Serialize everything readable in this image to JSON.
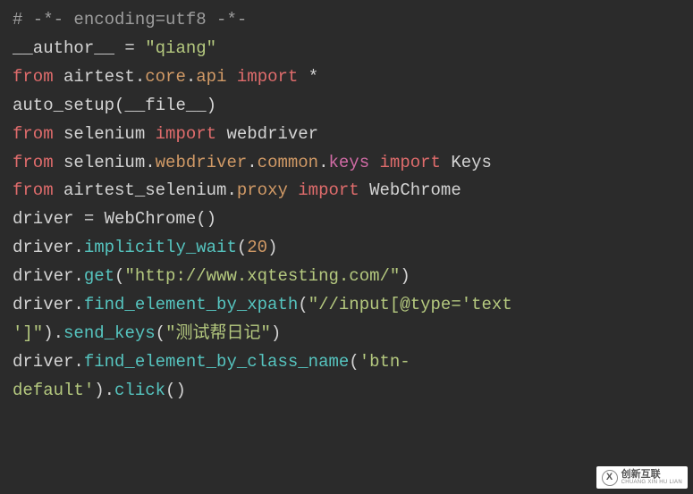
{
  "code": {
    "line1": {
      "comment": "# -*- encoding=utf8 -*-"
    },
    "line2": {
      "var": "__author__",
      "eq": " = ",
      "str": "\"qiang\""
    },
    "line3": {
      "blank": ""
    },
    "line4": {
      "from": "from",
      "sp1": " ",
      "mod": "airtest",
      "dot1": ".",
      "sub1": "core",
      "dot2": ".",
      "sub2": "api",
      "sp2": " ",
      "import": "import",
      "sp3": " ",
      "star": "*"
    },
    "line5": {
      "blank": ""
    },
    "line6": {
      "func": "auto_setup",
      "paren_open": "(",
      "arg": "__file__",
      "paren_close": ")"
    },
    "line7": {
      "from": "from",
      "sp1": " ",
      "mod": "selenium",
      "sp2": " ",
      "import": "import",
      "sp3": " ",
      "name": "webdriver"
    },
    "line8": {
      "from": "from",
      "sp1": " ",
      "mod": "selenium",
      "dot1": ".",
      "sub1": "webdriver",
      "dot2": ".",
      "sub2": "common",
      "dot3": ".",
      "sub3": "keys",
      "sp2": " ",
      "import": "import",
      "sp3": " ",
      "name": "Keys"
    },
    "line9": {
      "from": "from",
      "sp1": " ",
      "mod": "airtest_selenium",
      "dot1": ".",
      "sub1": "proxy",
      "sp2": " ",
      "import": "import",
      "sp3": " ",
      "name": "WebChrome"
    },
    "line10": {
      "assign": "driver = WebChrome()"
    },
    "line11": {
      "obj": "driver.",
      "method": "implicitly_wait",
      "open": "(",
      "num": "20",
      "close": ")"
    },
    "line12": {
      "obj": "driver.",
      "method": "get",
      "open": "(",
      "str": "\"http://www.xqtesting.com/\"",
      "close": ")"
    },
    "line13a": {
      "obj": "driver.",
      "method": "find_element_by_xpath",
      "open": "(",
      "str_part1": "\"//input[@type='text"
    },
    "line13b": {
      "str_part2": "']\"",
      "close1": ").",
      "method2": "send_keys",
      "open2": "(",
      "str2": "\"测试帮日记\"",
      "close2": ")"
    },
    "line14a": {
      "obj": "driver.",
      "method": "find_element_by_class_name",
      "open": "(",
      "str_part1": "'btn-"
    },
    "line14b": {
      "str_part2": "default'",
      "close1": ").",
      "method2": "click",
      "parens": "()"
    }
  },
  "watermark": {
    "logo_letter": "X",
    "main_text": "创新互联",
    "sub_text": "CHUANG XIN HU LIAN"
  }
}
